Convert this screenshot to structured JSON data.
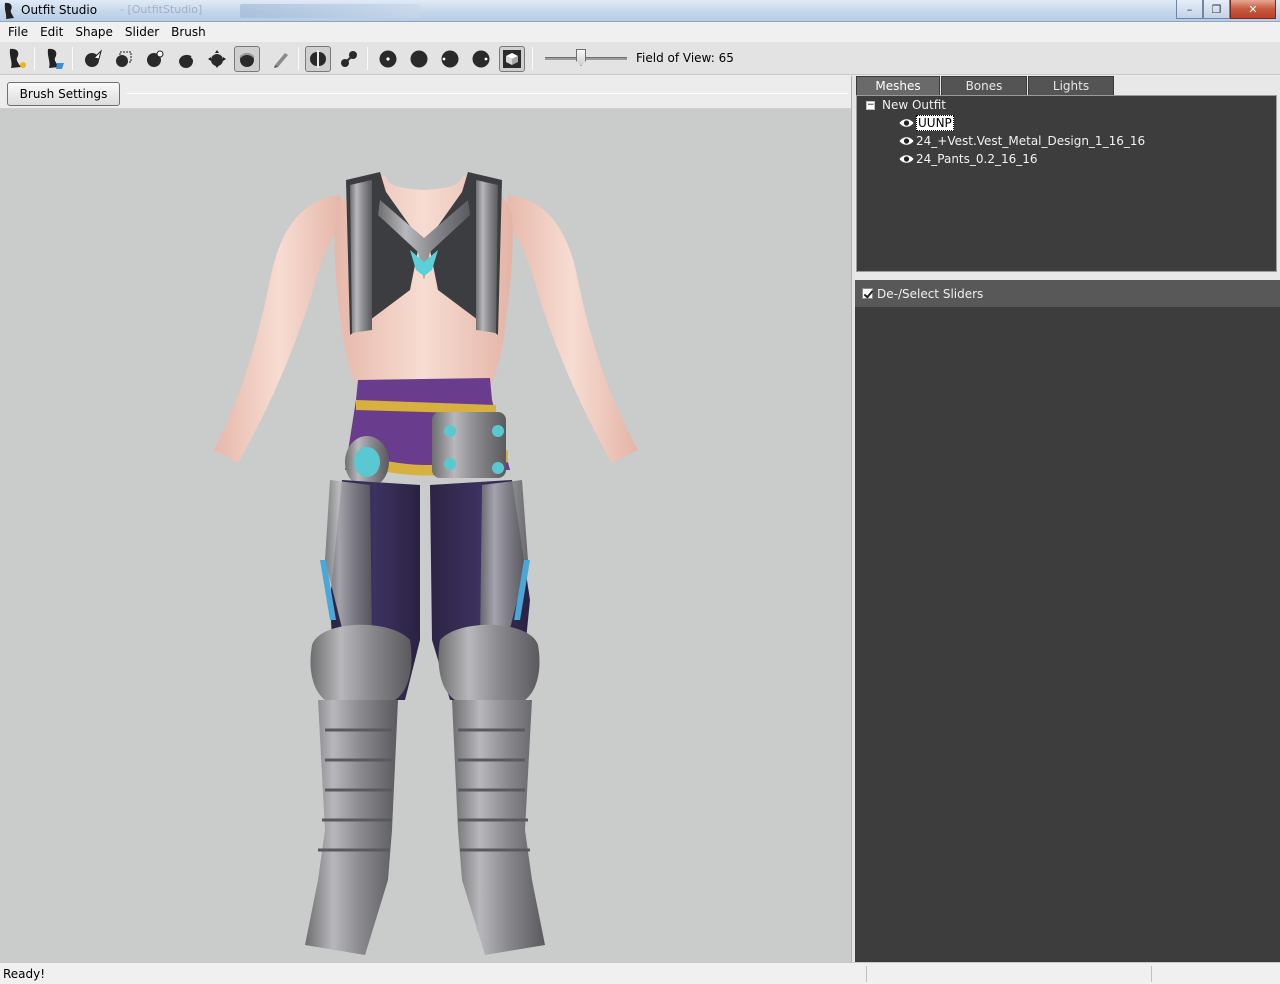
{
  "window": {
    "title": "Outfit Studio",
    "ghost_title": "- [OutfitStudio]"
  },
  "menu": [
    "File",
    "Edit",
    "Shape",
    "Slider",
    "Brush"
  ],
  "toolbar": {
    "tools": [
      "new-project-icon",
      "load-reference-icon",
      "select-icon",
      "mask-icon",
      "inflate-brush-icon",
      "deflate-brush-icon",
      "move-brush-icon",
      "smooth-brush-icon",
      "weight-brush-icon",
      "mirror-x-icon",
      "connected-icon",
      "brush-size-small-icon",
      "brush-size-medium-icon",
      "brush-falloff-icon",
      "brush-strength-icon",
      "view-cube-icon"
    ],
    "fov_label": "Field of View: 65",
    "fov_value": 65
  },
  "brush_settings": {
    "label": "Brush Settings >>"
  },
  "tabs": [
    "Meshes",
    "Bones",
    "Lights"
  ],
  "active_tab": "Meshes",
  "tree": {
    "root": "New Outfit",
    "items": [
      "UUNP",
      "24_+Vest.Vest_Metal_Design_1_16_16",
      "24_Pants_0.2_16_16"
    ],
    "selected": "UUNP"
  },
  "sliders": {
    "header": "De-/Select Sliders",
    "checked": true
  },
  "status": {
    "text": "Ready!"
  },
  "colors": {
    "viewport_bg": "#c9cccb",
    "panel_dark": "#3d3d3d",
    "tab_bg": "#545454"
  }
}
